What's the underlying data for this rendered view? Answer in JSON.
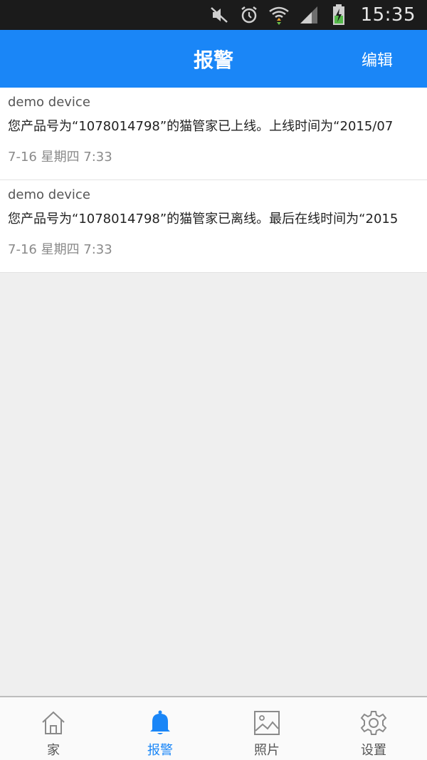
{
  "status_bar": {
    "time": "15:35",
    "icons": [
      "mute-icon",
      "alarm-clock-icon",
      "wifi-icon",
      "signal-icon",
      "battery-charging-icon"
    ]
  },
  "header": {
    "title": "报警",
    "edit_label": "编辑"
  },
  "alarms": [
    {
      "device": "demo device",
      "message": "您产品号为“1078014798”的猫管家已上线。上线时间为“2015/07",
      "time": "7-16 星期四 7:33"
    },
    {
      "device": "demo device",
      "message": "您产品号为“1078014798”的猫管家已离线。最后在线时间为“2015",
      "time": "7-16 星期四 7:33"
    }
  ],
  "tabs": [
    {
      "label": "家",
      "icon": "home-icon",
      "active": false
    },
    {
      "label": "报警",
      "icon": "bell-icon",
      "active": true
    },
    {
      "label": "照片",
      "icon": "photo-icon",
      "active": false
    },
    {
      "label": "设置",
      "icon": "gear-icon",
      "active": false
    }
  ],
  "colors": {
    "accent": "#1a86f7",
    "status_bar_bg": "#1b1b1b",
    "list_bg": "#ffffff",
    "page_bg": "#efefef"
  }
}
